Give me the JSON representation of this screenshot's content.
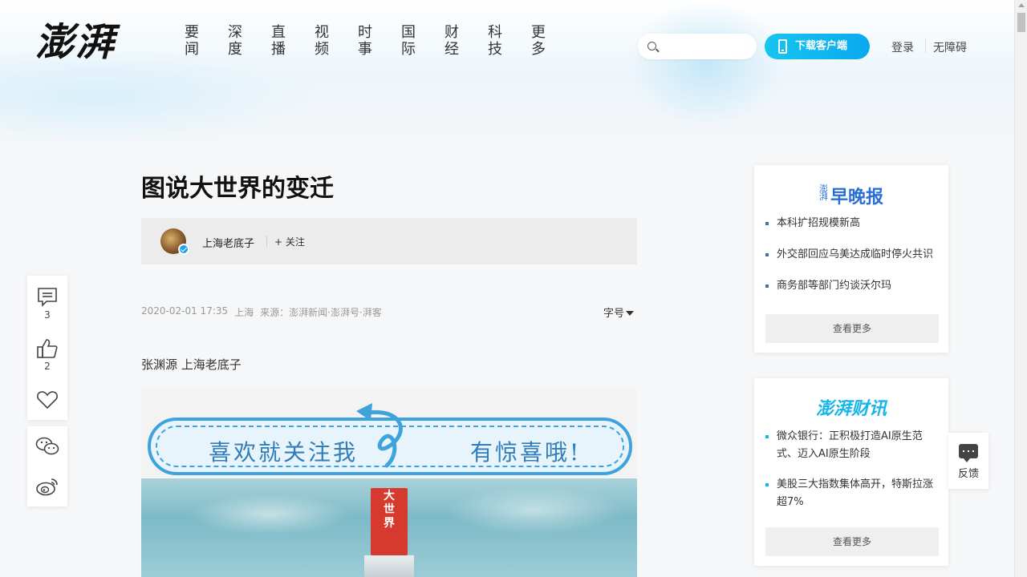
{
  "header": {
    "logo_text": "澎湃",
    "nav": [
      {
        "label": "要闻"
      },
      {
        "label": "深度"
      },
      {
        "label": "直播"
      },
      {
        "label": "视频"
      },
      {
        "label": "时事"
      },
      {
        "label": "国际"
      },
      {
        "label": "财经"
      },
      {
        "label": "科技"
      },
      {
        "label": "更多"
      }
    ],
    "search_placeholder": "",
    "download_label": "下载客户端",
    "login_label": "登录",
    "accessible_label": "无障碍"
  },
  "article": {
    "title": "图说大世界的变迁",
    "author": "上海老底子",
    "follow_label": "关注",
    "date": "2020-02-01 17:35",
    "location": "上海",
    "source": "来源：澎湃新闻·澎湃号·湃客",
    "font_size_label": "字号",
    "byline": "张渊源 上海老底子",
    "image_banner_left": "喜欢就关注我",
    "image_banner_right": "有惊喜哦!",
    "image_tower_text": "大世界"
  },
  "left_toolbar": {
    "comment_count": "3",
    "like_count": "2"
  },
  "sidebar": {
    "card1": {
      "logo_prefix": "澎湃",
      "logo": "早晚报",
      "items": [
        {
          "text": "本科扩招规模新高"
        },
        {
          "text": "外交部回应乌美达成临时停火共识"
        },
        {
          "text": "商务部等部门约谈沃尔玛"
        }
      ],
      "more_label": "查看更多"
    },
    "card2": {
      "logo": "澎湃财讯",
      "items": [
        {
          "text": "微众银行：正积极打造AI原生范式、迈入AI原生阶段"
        },
        {
          "text": "美股三大指数集体高开，特斯拉涨超7%"
        }
      ],
      "more_label": "查看更多"
    }
  },
  "feedback": {
    "label": "反馈"
  },
  "colors": {
    "brand_blue": "#0aa9ef",
    "card1_accent": "#2a6fd6",
    "card2_accent": "#16b6ec"
  }
}
